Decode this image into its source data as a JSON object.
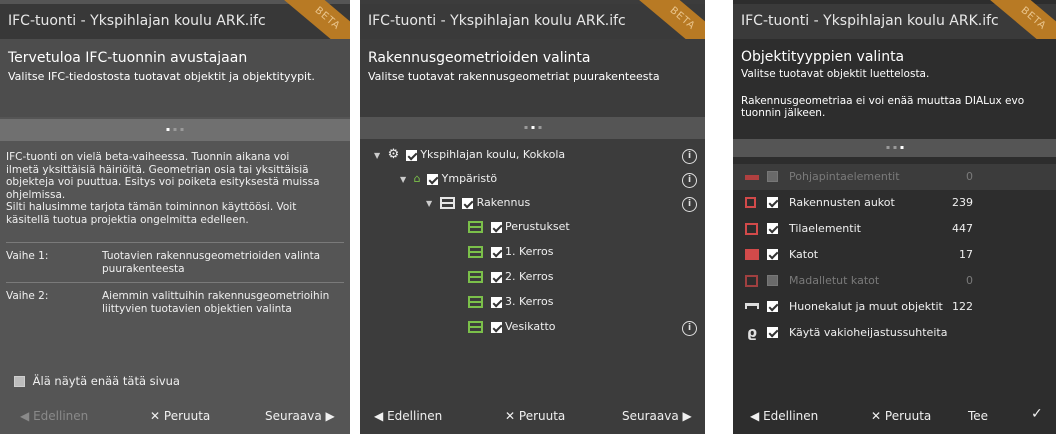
{
  "common": {
    "window_title": "IFC-tuonti - Ykspihlajan koulu ARK.ifc",
    "beta": "BETA",
    "prev": "Edellinen",
    "cancel": "Peruuta",
    "next": "Seuraava",
    "finish": "Tee"
  },
  "panel1": {
    "heading": "Tervetuloa IFC-tuonnin avustajaan",
    "subheading": "Valitse IFC-tiedostosta tuotavat objektit ja objektityypit.",
    "intro_lines": [
      "IFC-tuonti on vielä beta-vaiheessa. Tuonnin aikana voi",
      "ilmetä yksittäisiä häiriöitä. Geometrian osia tai yksittäisiä",
      "objekteja voi puuttua. Esitys voi poiketa esityksestä muissa",
      "ohjelmissa.",
      "Silti halusimme tarjota tämän toiminnon käyttöösi. Voit",
      "käsitellä tuotua projektia ongelmitta edelleen."
    ],
    "steps": [
      {
        "label": "Vaihe 1:",
        "lines": [
          "Tuotavien rakennusgeometrioiden valinta",
          "puurakenteesta"
        ]
      },
      {
        "label": "Vaihe 2:",
        "lines": [
          "Aiemmin valittuihin rakennusgeometrioihin",
          "liittyvien tuotavien objektien valinta"
        ]
      }
    ],
    "dont_show_label": "Älä näytä enää tätä sivua",
    "dont_show_checked": false
  },
  "panel2": {
    "heading": "Rakennusgeometrioiden valinta",
    "subheading": "Valitse tuotavat rakennusgeometriat puurakenteesta",
    "tree": [
      {
        "label": "Ykspihlajan koulu, Kokkola",
        "checked": true,
        "icon": "project-icon",
        "info": true
      },
      {
        "label": "Ympäristö",
        "checked": true,
        "icon": "site-icon",
        "info": true
      },
      {
        "label": "Rakennus",
        "checked": true,
        "icon": "building-icon",
        "info": true
      },
      {
        "label": "Perustukset",
        "checked": true,
        "icon": "storey-icon",
        "info": false
      },
      {
        "label": "1. Kerros",
        "checked": true,
        "icon": "storey-icon",
        "info": false
      },
      {
        "label": "2. Kerros",
        "checked": true,
        "icon": "storey-icon",
        "info": false
      },
      {
        "label": "3. Kerros",
        "checked": true,
        "icon": "storey-icon",
        "info": false
      },
      {
        "label": "Vesikatto",
        "checked": true,
        "icon": "storey-icon",
        "info": true
      }
    ]
  },
  "panel3": {
    "heading": "Objektityyppien valinta",
    "subheading": "Valitse tuotavat objektit luettelosta.",
    "note_lines": [
      "Rakennusgeometriaa ei voi enää muuttaa DIALux evo",
      "tuonnin jälkeen."
    ],
    "objects": [
      {
        "label": "Pohjapintaelementit",
        "count": "0",
        "checked": false,
        "enabled": false,
        "icon": "floor-element-icon"
      },
      {
        "label": "Rakennusten aukot",
        "count": "239",
        "checked": true,
        "enabled": true,
        "icon": "opening-icon"
      },
      {
        "label": "Tilaelementit",
        "count": "447",
        "checked": true,
        "enabled": true,
        "icon": "space-element-icon"
      },
      {
        "label": "Katot",
        "count": "17",
        "checked": true,
        "enabled": true,
        "icon": "ceiling-icon"
      },
      {
        "label": "Madalletut katot",
        "count": "0",
        "checked": false,
        "enabled": false,
        "icon": "suspended-ceiling-icon"
      },
      {
        "label": "Huonekalut ja muut objektit",
        "count": "122",
        "checked": true,
        "enabled": true,
        "icon": "furniture-icon"
      },
      {
        "label": "Käytä vakioheijastussuhteita",
        "count": "",
        "checked": true,
        "enabled": true,
        "icon": "reflectance-icon"
      }
    ]
  },
  "colors": {
    "beta_ribbon": "#b87a24",
    "storey_green": "#7bc04a",
    "site_green": "#7bc04a"
  }
}
